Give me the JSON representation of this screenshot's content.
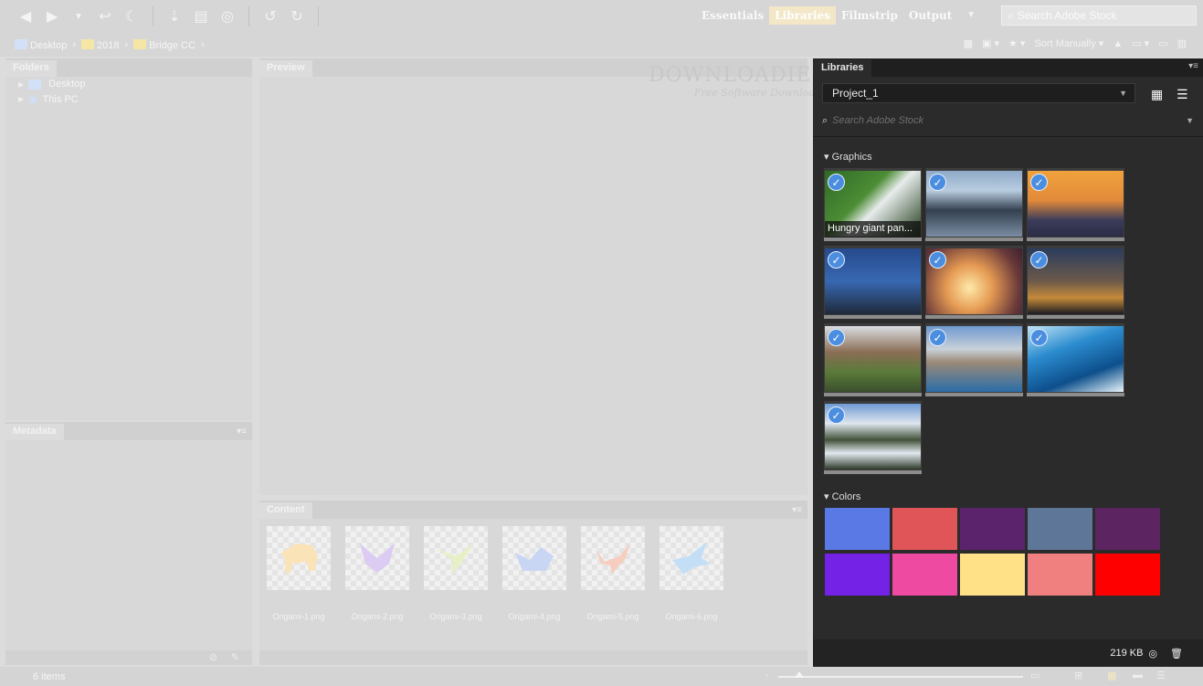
{
  "toolbar": {
    "workspaces": [
      "Essentials",
      "Libraries",
      "Filmstrip",
      "Output"
    ],
    "active_workspace": "Libraries",
    "stock_search_placeholder": "Search Adobe Stock"
  },
  "pathbar": {
    "crumbs": [
      "Desktop",
      "2018",
      "Bridge CC"
    ],
    "sort_label": "Sort Manually"
  },
  "panels": {
    "folders_tab": "Folders",
    "preview_tab": "Preview",
    "metadata_tab": "Metadata",
    "content_tab": "Content",
    "folders": [
      "Desktop",
      "This PC"
    ]
  },
  "content": {
    "items": [
      {
        "name": "Origami-1.png",
        "color": "#fbe3b8"
      },
      {
        "name": "Origami-2.png",
        "color": "#dccbf3"
      },
      {
        "name": "Origami-3.png",
        "color": "#e6f0c4"
      },
      {
        "name": "Origami-4.png",
        "color": "#c9d6f3"
      },
      {
        "name": "Origami-5.png",
        "color": "#f6cdbe"
      },
      {
        "name": "Origami-6.png",
        "color": "#c4def6"
      }
    ]
  },
  "watermark": {
    "title": "DOWNLOADIES",
    "subtitle": "Free Software Downloads"
  },
  "libraries": {
    "tab": "Libraries",
    "selected_library": "Project_1",
    "search_placeholder": "Search Adobe Stock",
    "graphics_heading": "Graphics",
    "colors_heading": "Colors",
    "graphics": [
      {
        "caption": "Hungry giant pan...",
        "bg": "linear-gradient(135deg,#2f6a27 0%,#4c8d35 40%,#e8ecec 55%,#1e3a18 100%)"
      },
      {
        "caption": "",
        "bg": "linear-gradient(180deg,#8fa9c8 0%,#b9cde0 30%,#33404f 60%,#7b8da3 100%)"
      },
      {
        "caption": "",
        "bg": "linear-gradient(180deg,#f0a23d 0%,#e38a3a 45%,#3a3c5a 75%,#2b2d46 100%)"
      },
      {
        "caption": "",
        "bg": "linear-gradient(180deg,#264a8c 0%,#3868b2 50%,#1f2a3a 100%)"
      },
      {
        "caption": "",
        "bg": "radial-gradient(circle at 45% 60%,#ffe9a8 0%,#e59a53 35%,#6a3a3a 75%,#3a2030 100%)"
      },
      {
        "caption": "",
        "bg": "linear-gradient(180deg,#2a3c5c 0%,#6d5a4a 50%,#c58a3a 75%,#1b1b22 100%)"
      },
      {
        "caption": "",
        "bg": "linear-gradient(180deg,#d9dde2 0%,#8a6d55 40%,#5a7a3a 70%,#3b4f2c 100%)"
      },
      {
        "caption": "",
        "bg": "linear-gradient(180deg,#6f9ad0 0%,#c9d1d8 35%,#9a8a78 55%,#2a6ea8 100%)"
      },
      {
        "caption": "",
        "bg": "linear-gradient(160deg,#bfe4f5 0%,#2b8ccf 35%,#0d4f8c 70%,#e8f4fa 100%)"
      },
      {
        "caption": "",
        "bg": "linear-gradient(180deg,#6e9ad4 0%,#dfe6ee 30%,#43523a 55%,#e3e9ef 75%,#2e3a2a 100%)"
      }
    ],
    "colors": [
      "#5a79e4",
      "#e05658",
      "#5c236d",
      "#5e7799",
      "#5c2460",
      "#7322e6",
      "#ee4aa1",
      "#ffe187",
      "#f08080",
      "#ff0000"
    ],
    "footer_size": "219 KB"
  },
  "statusbar": {
    "items_count": "6 items"
  }
}
